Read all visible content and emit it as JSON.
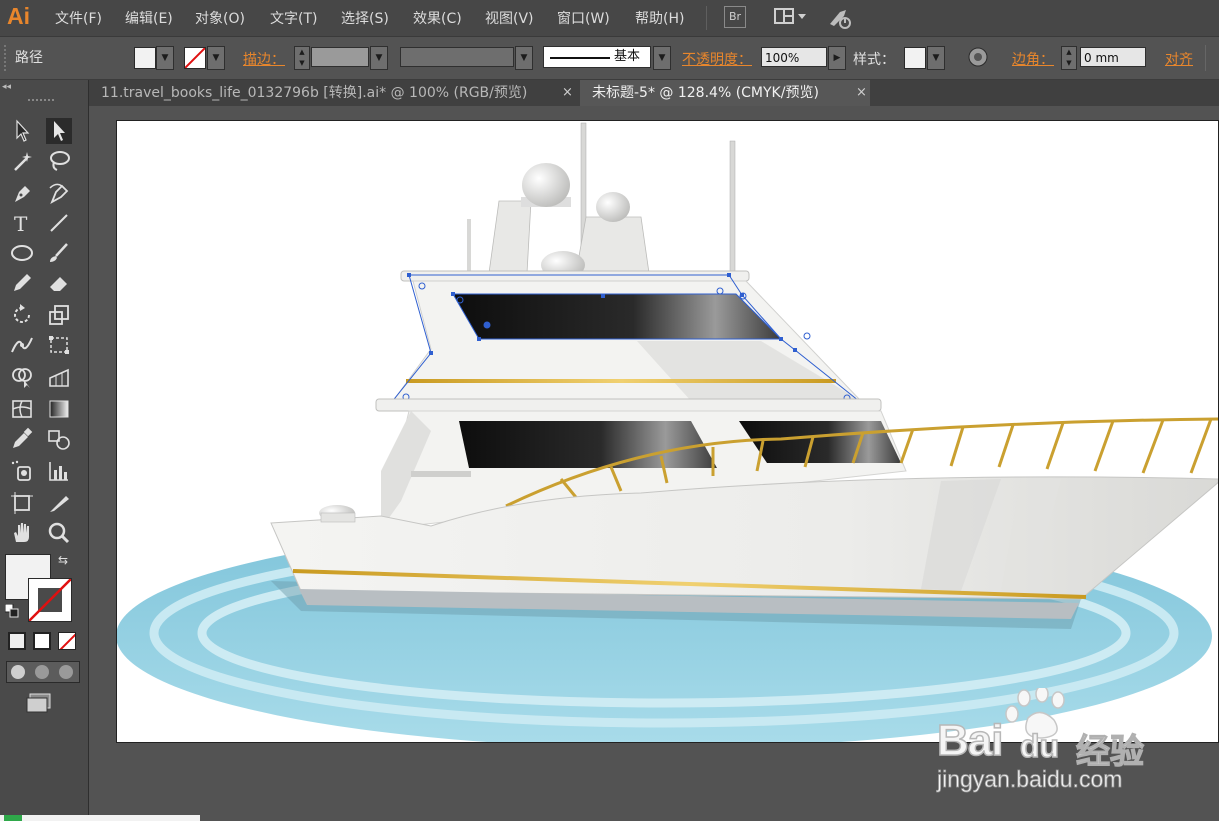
{
  "app": {
    "logo": "Ai"
  },
  "menu": [
    "文件(F)",
    "编辑(E)",
    "对象(O)",
    "文字(T)",
    "选择(S)",
    "效果(C)",
    "视图(V)",
    "窗口(W)",
    "帮助(H)"
  ],
  "menubar_buttons": {
    "bridge": "Br"
  },
  "control_bar": {
    "selection_type": "路径",
    "stroke_label": "描边：",
    "stroke_style": "基本",
    "opacity_label": "不透明度：",
    "opacity_value": "100%",
    "style_label": "样式：",
    "corner_label": "边角：",
    "corner_value": "0 mm",
    "align_label": "对齐"
  },
  "tabs": [
    {
      "label": "11.travel_books_life_0132796b [转换].ai* @ 100% (RGB/预览)",
      "close": "×"
    },
    {
      "label": "未标题-5* @ 128.4% (CMYK/预览)",
      "close": "×"
    }
  ],
  "tools": [
    "selection-tool",
    "direct-selection-tool",
    "magic-wand-tool",
    "lasso-tool",
    "pen-tool",
    "curvature-tool",
    "type-tool",
    "line-tool",
    "ellipse-tool",
    "paintbrush-tool",
    "pencil-tool",
    "eraser-tool",
    "rotate-tool",
    "scale-tool",
    "width-tool",
    "free-transform-tool",
    "shape-builder-tool",
    "perspective-grid-tool",
    "mesh-tool",
    "gradient-tool",
    "eyedropper-tool",
    "blend-tool",
    "symbol-sprayer-tool",
    "column-graph-tool",
    "artboard-tool",
    "slice-tool",
    "hand-tool",
    "zoom-tool"
  ],
  "watermark": {
    "brand_left": "Bai",
    "brand_right": "du",
    "product": "经验",
    "url": "jingyan.baidu.com"
  },
  "colors": {
    "accent": "#e8862c",
    "selection": "#2f5fd0",
    "water": "#8fcfe0"
  }
}
